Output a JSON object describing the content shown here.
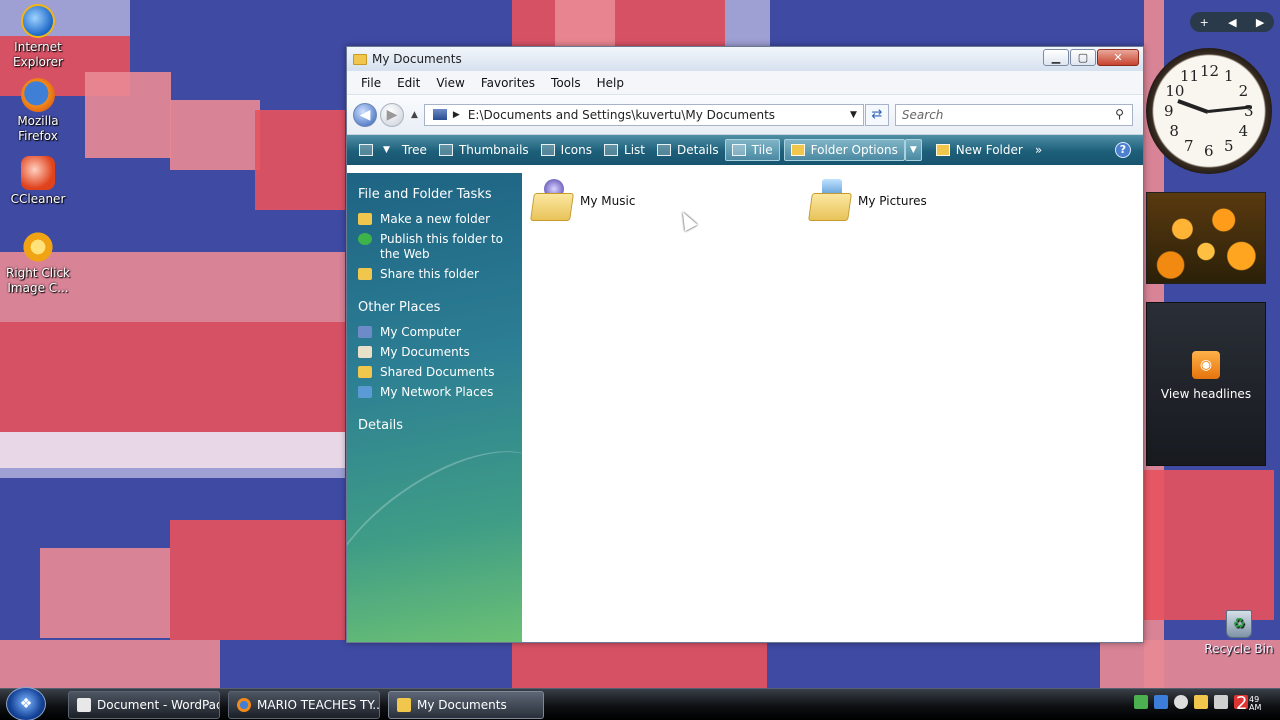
{
  "desktop": {
    "icons": [
      {
        "label": "Internet Explorer",
        "icon": "internet-explorer-icon"
      },
      {
        "label": "Mozilla Firefox",
        "icon": "firefox-icon"
      },
      {
        "label": "CCleaner",
        "icon": "ccleaner-icon"
      },
      {
        "label": "Right Click Image C...",
        "icon": "gear-icon"
      }
    ],
    "recycle_bin": "Recycle Bin",
    "colors": {
      "background": "#3f4aa3",
      "tile_red": "#e8525e",
      "tile_pink": "#e98a95",
      "tile_lavender": "#a9a8d8"
    }
  },
  "window": {
    "title": "My Documents",
    "controls": {
      "minimize": "▁",
      "maximize": "▢",
      "close": "✕"
    },
    "menu": [
      "File",
      "Edit",
      "View",
      "Favorites",
      "Tools",
      "Help"
    ],
    "address": "E:\\Documents and Settings\\kuvertu\\My Documents",
    "search_placeholder": "Search",
    "toolbar": {
      "tree": "Tree",
      "thumbnails": "Thumbnails",
      "icons": "Icons",
      "list": "List",
      "details": "Details",
      "tile": "Tile",
      "folder_options": "Folder Options",
      "new_folder": "New Folder",
      "more": "»",
      "help": "?"
    },
    "left_pane": {
      "file_folder_tasks": {
        "heading": "File and Folder Tasks",
        "items": [
          "Make a new folder",
          "Publish this folder to the Web",
          "Share this folder"
        ]
      },
      "other_places": {
        "heading": "Other Places",
        "items": [
          "My Computer",
          "My Documents",
          "Shared Documents",
          "My Network Places"
        ]
      },
      "details": {
        "heading": "Details"
      }
    },
    "files": [
      {
        "name": "My Music",
        "icon": "music-folder-icon"
      },
      {
        "name": "My Pictures",
        "icon": "pictures-folder-icon"
      }
    ]
  },
  "sidebar": {
    "gadget_bar": {
      "add": "+",
      "prev": "◀",
      "next": "▶"
    },
    "clock_numbers": [
      "12",
      "1",
      "2",
      "3",
      "4",
      "5",
      "6",
      "7",
      "8",
      "9",
      "10",
      "11"
    ],
    "feed_label": "View headlines"
  },
  "taskbar": {
    "start": "❖",
    "buttons": [
      "Document - WordPad",
      "MARIO TEACHES TY...",
      "My Documents"
    ],
    "active_button": "My Documents",
    "clock_hour": "2",
    "clock_minutes": "49",
    "clock_ampm": "AM"
  }
}
